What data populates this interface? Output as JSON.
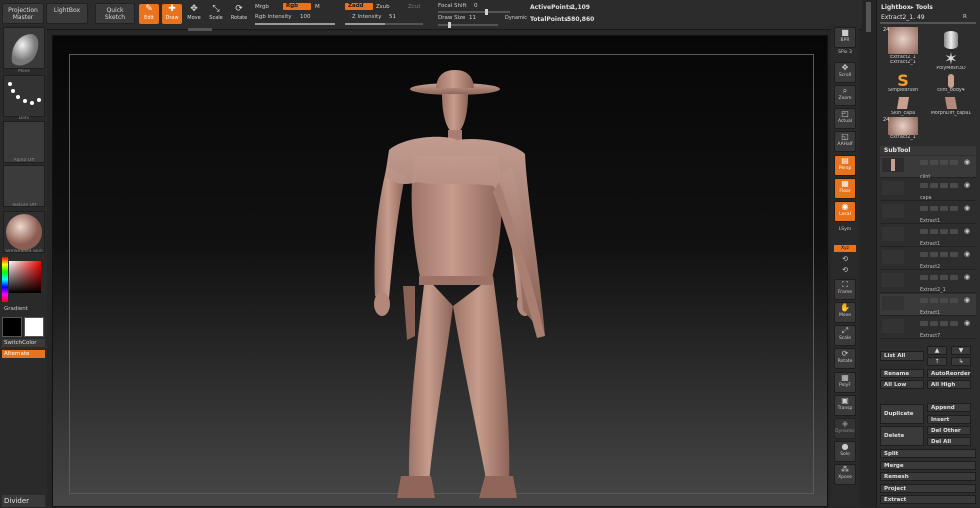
{
  "topbar": {
    "projection_master": "Projection Master",
    "lightbox": "LightBox",
    "quick_sketch": "Quick Sketch",
    "tools": [
      {
        "label": "Edit",
        "glyph": "✎",
        "active": true
      },
      {
        "label": "Draw",
        "glyph": "✚",
        "active": true
      },
      {
        "label": "Move",
        "glyph": "✥",
        "active": false
      },
      {
        "label": "Scale",
        "glyph": "⤡",
        "active": false
      },
      {
        "label": "Rotate",
        "glyph": "⟳",
        "active": false
      }
    ],
    "mrgb": "Mrgb",
    "rgb": "Rgb",
    "m": "M",
    "rgb_intensity_label": "Rgb Intensity",
    "rgb_intensity_value": "100",
    "zadd": "Zadd",
    "zsub": "Zsub",
    "zcut": "Zcut",
    "z_intensity_label": "Z Intensity",
    "z_intensity_value": "51",
    "focal_shift_label": "Focal Shift",
    "focal_shift_value": "0",
    "draw_size_label": "Draw Size",
    "draw_size_value": "11",
    "dynamic": "Dynamic",
    "active_points_label": "ActivePoints:",
    "active_points_value": "1,109",
    "total_points_label": "TotalPoints:",
    "total_points_value": "580,860"
  },
  "leftbar": {
    "items": [
      {
        "caption": "Move"
      },
      {
        "caption": "Dots"
      },
      {
        "caption": "Alpha Off"
      },
      {
        "caption": "Texture Off"
      },
      {
        "caption": "SkinShade4 Skin"
      }
    ],
    "gradient": "Gradient",
    "switch_color": "SwitchColor",
    "alternate": "Alternate",
    "divider": "Divider"
  },
  "rightshelf": {
    "spix_label": "SPix",
    "spix_value": "3",
    "tools": [
      "BPR",
      "Scroll",
      "Zoom",
      "Actual",
      "AAHalf",
      "Persp",
      "Floor",
      "Local",
      "LSym",
      "Xyz",
      "",
      "",
      "Frame",
      "Move",
      "Scale",
      "Rotate",
      "PolyF",
      "Transp",
      "Dynamic",
      "Solo",
      "Xpose"
    ]
  },
  "rpanel": {
    "title": "Lightbox▸ Tools",
    "current_tool": "Extract2_1. 49",
    "r_button": "R",
    "tools": [
      {
        "label": "Extract2_1",
        "badge": "24"
      },
      {
        "label": "Cylinder3D",
        "badge": ""
      },
      {
        "label": "Extract2_1",
        "badge": ""
      },
      {
        "label": "PolyMesh3D",
        "badge": ""
      },
      {
        "label": "SimpleBrush",
        "badge": ""
      },
      {
        "label": "clint_body4",
        "badge": ""
      },
      {
        "label": "Skin_capa",
        "badge": ""
      },
      {
        "label": "MorphDiff_capa1",
        "badge": ""
      },
      {
        "label": "Extract2_1",
        "badge": "24"
      }
    ],
    "subtool_title": "SubTool",
    "subtools": [
      "",
      "clint",
      "capa",
      "Extract1",
      "Extract1",
      "Extract2",
      "Extract2_1",
      "Extract1",
      "Extract7"
    ],
    "list_all": "List All",
    "rename": "Rename",
    "auto_reorder": "AutoReorder",
    "all_low": "All Low",
    "all_high": "All High",
    "duplicate": "Duplicate",
    "append": "Append",
    "insert": "Insert",
    "delete": "Delete",
    "del_other": "Del Other",
    "del_all": "Del All",
    "split": "Split",
    "merge": "Merge",
    "remesh": "Remesh",
    "project": "Project",
    "extract": "Extract"
  },
  "colors": {
    "accent": "#e8731c",
    "panel": "#2d2d2d",
    "clay": "#b58a7c"
  }
}
